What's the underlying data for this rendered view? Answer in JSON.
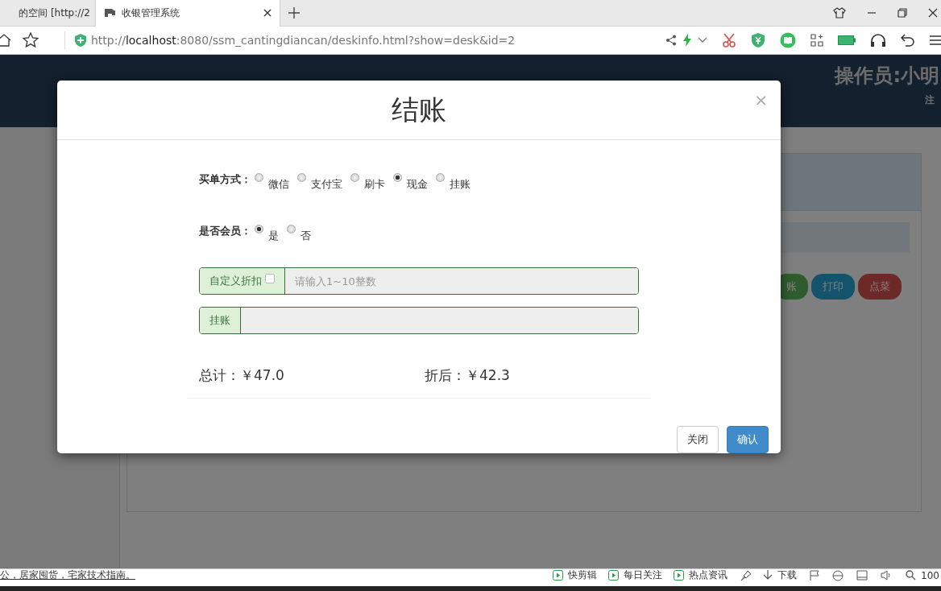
{
  "browser": {
    "tabs": [
      {
        "title": "的空间 [http://2",
        "selected": false
      },
      {
        "title": "收银管理系统",
        "selected": true
      }
    ],
    "url": {
      "scheme": "http://",
      "host": "localhost",
      "rest": ":8080/ssm_cantingdiancan/deskinfo.html?show=desk&id=2"
    }
  },
  "app_header": {
    "operator": "操作员:小明",
    "logout": "注"
  },
  "background_buttons": [
    {
      "label": "账",
      "kind": "success"
    },
    {
      "label": "打印",
      "kind": "info"
    },
    {
      "label": "点菜",
      "kind": "danger"
    }
  ],
  "modal": {
    "title": "结账",
    "close": "×",
    "payment": {
      "label": "买单方式：",
      "options": [
        {
          "label": "微信",
          "selected": false
        },
        {
          "label": "支付宝",
          "selected": false
        },
        {
          "label": "刷卡",
          "selected": false
        },
        {
          "label": "现金",
          "selected": true
        },
        {
          "label": "挂账",
          "selected": false
        }
      ]
    },
    "member": {
      "label": "是否会员：",
      "options": [
        {
          "label": "是",
          "selected": true
        },
        {
          "label": "否",
          "selected": false
        }
      ]
    },
    "discount": {
      "addon": "自定义折扣",
      "checked": false,
      "placeholder": "请输入1~10整数"
    },
    "credit": {
      "addon": "挂账"
    },
    "total": "总计：￥47.0",
    "discounted": "折后：￥42.3",
    "buttons": [
      {
        "label": "关闭",
        "kind": "default"
      },
      {
        "label": "确认",
        "kind": "primary"
      }
    ]
  },
  "status_bar": {
    "text": "公，居家囤货，宅家技术指南。",
    "items": [
      {
        "label": "快剪辑"
      },
      {
        "label": "每日关注"
      },
      {
        "label": "热点资讯"
      }
    ],
    "download": "下载",
    "zoom": "100"
  }
}
